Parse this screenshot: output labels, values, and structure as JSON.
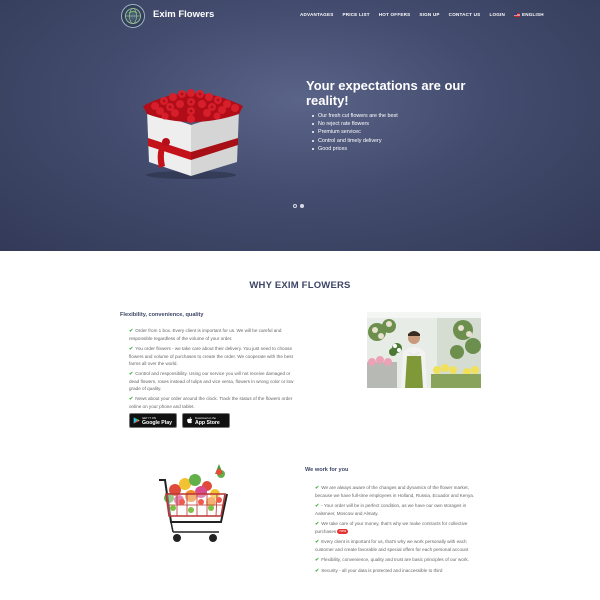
{
  "brand": {
    "name": "Exim Flowers",
    "logo_icon": "globe-logo-icon"
  },
  "nav": {
    "items": [
      "ADVANTAGES",
      "PRICE LIST",
      "HOT OFFERS",
      "SIGN UP",
      "CONTACT US",
      "LOGIN",
      "ENGLISH"
    ]
  },
  "hero": {
    "title": "Your expectations are our reality!",
    "bullets": [
      "Our fresh cut flowers are the best",
      "No reject rate flowers",
      "Premium servicec",
      "Control and timely delivery",
      "Good prices"
    ],
    "slides": 2,
    "active_slide": 1
  },
  "why": {
    "title": "WHY EXIM FLOWERS",
    "subtitle": "Flexibility, convenience, quality",
    "items": [
      "Order from 1 box. Every client is important for us. We will be careful and responsible regardless of the volume of your order.",
      "You order flowers - we take care about their delivery. You just need to choose flowers and volume of purchases to create the order. We cooperate with the best farms all over the world.",
      "Control and responsibility. Using our service you will not receive damaged or dead flowers, roses instead of tulips and vice versa, flowers in wrong color or low grade of quality.",
      "News about your order around the clock. Track the status of the flowers order online on your phone and tablet."
    ],
    "google_play": {
      "small": "GET IT ON",
      "big": "Google Play"
    },
    "app_store": {
      "small": "Download on the",
      "big": "App Store"
    }
  },
  "work": {
    "title": "We work for you",
    "items": [
      "We are always aware of the changes and dynamics of the flower market, because we have full-time employees in Holland, Russia, Ecuador and Kenya.",
      "- Your order will be in perfect condition, as we have our own storages in Aalsmeer, Moscow and Almaty.",
      "We take care of your money, that's why we make contracts for collective purchases",
      "Every client is important for us, that's why we work personally with each customer and create favorable and special offers for each personal account",
      "Flexibility, convenience, quality and trust are basic principles of our work.",
      "Security - all your data is protected and inaccessible to third"
    ],
    "badge": "new"
  },
  "colors": {
    "hero_bg": "#434c6e",
    "heading": "#3c4565",
    "check": "#3dac3d",
    "badge": "#e3322f"
  }
}
